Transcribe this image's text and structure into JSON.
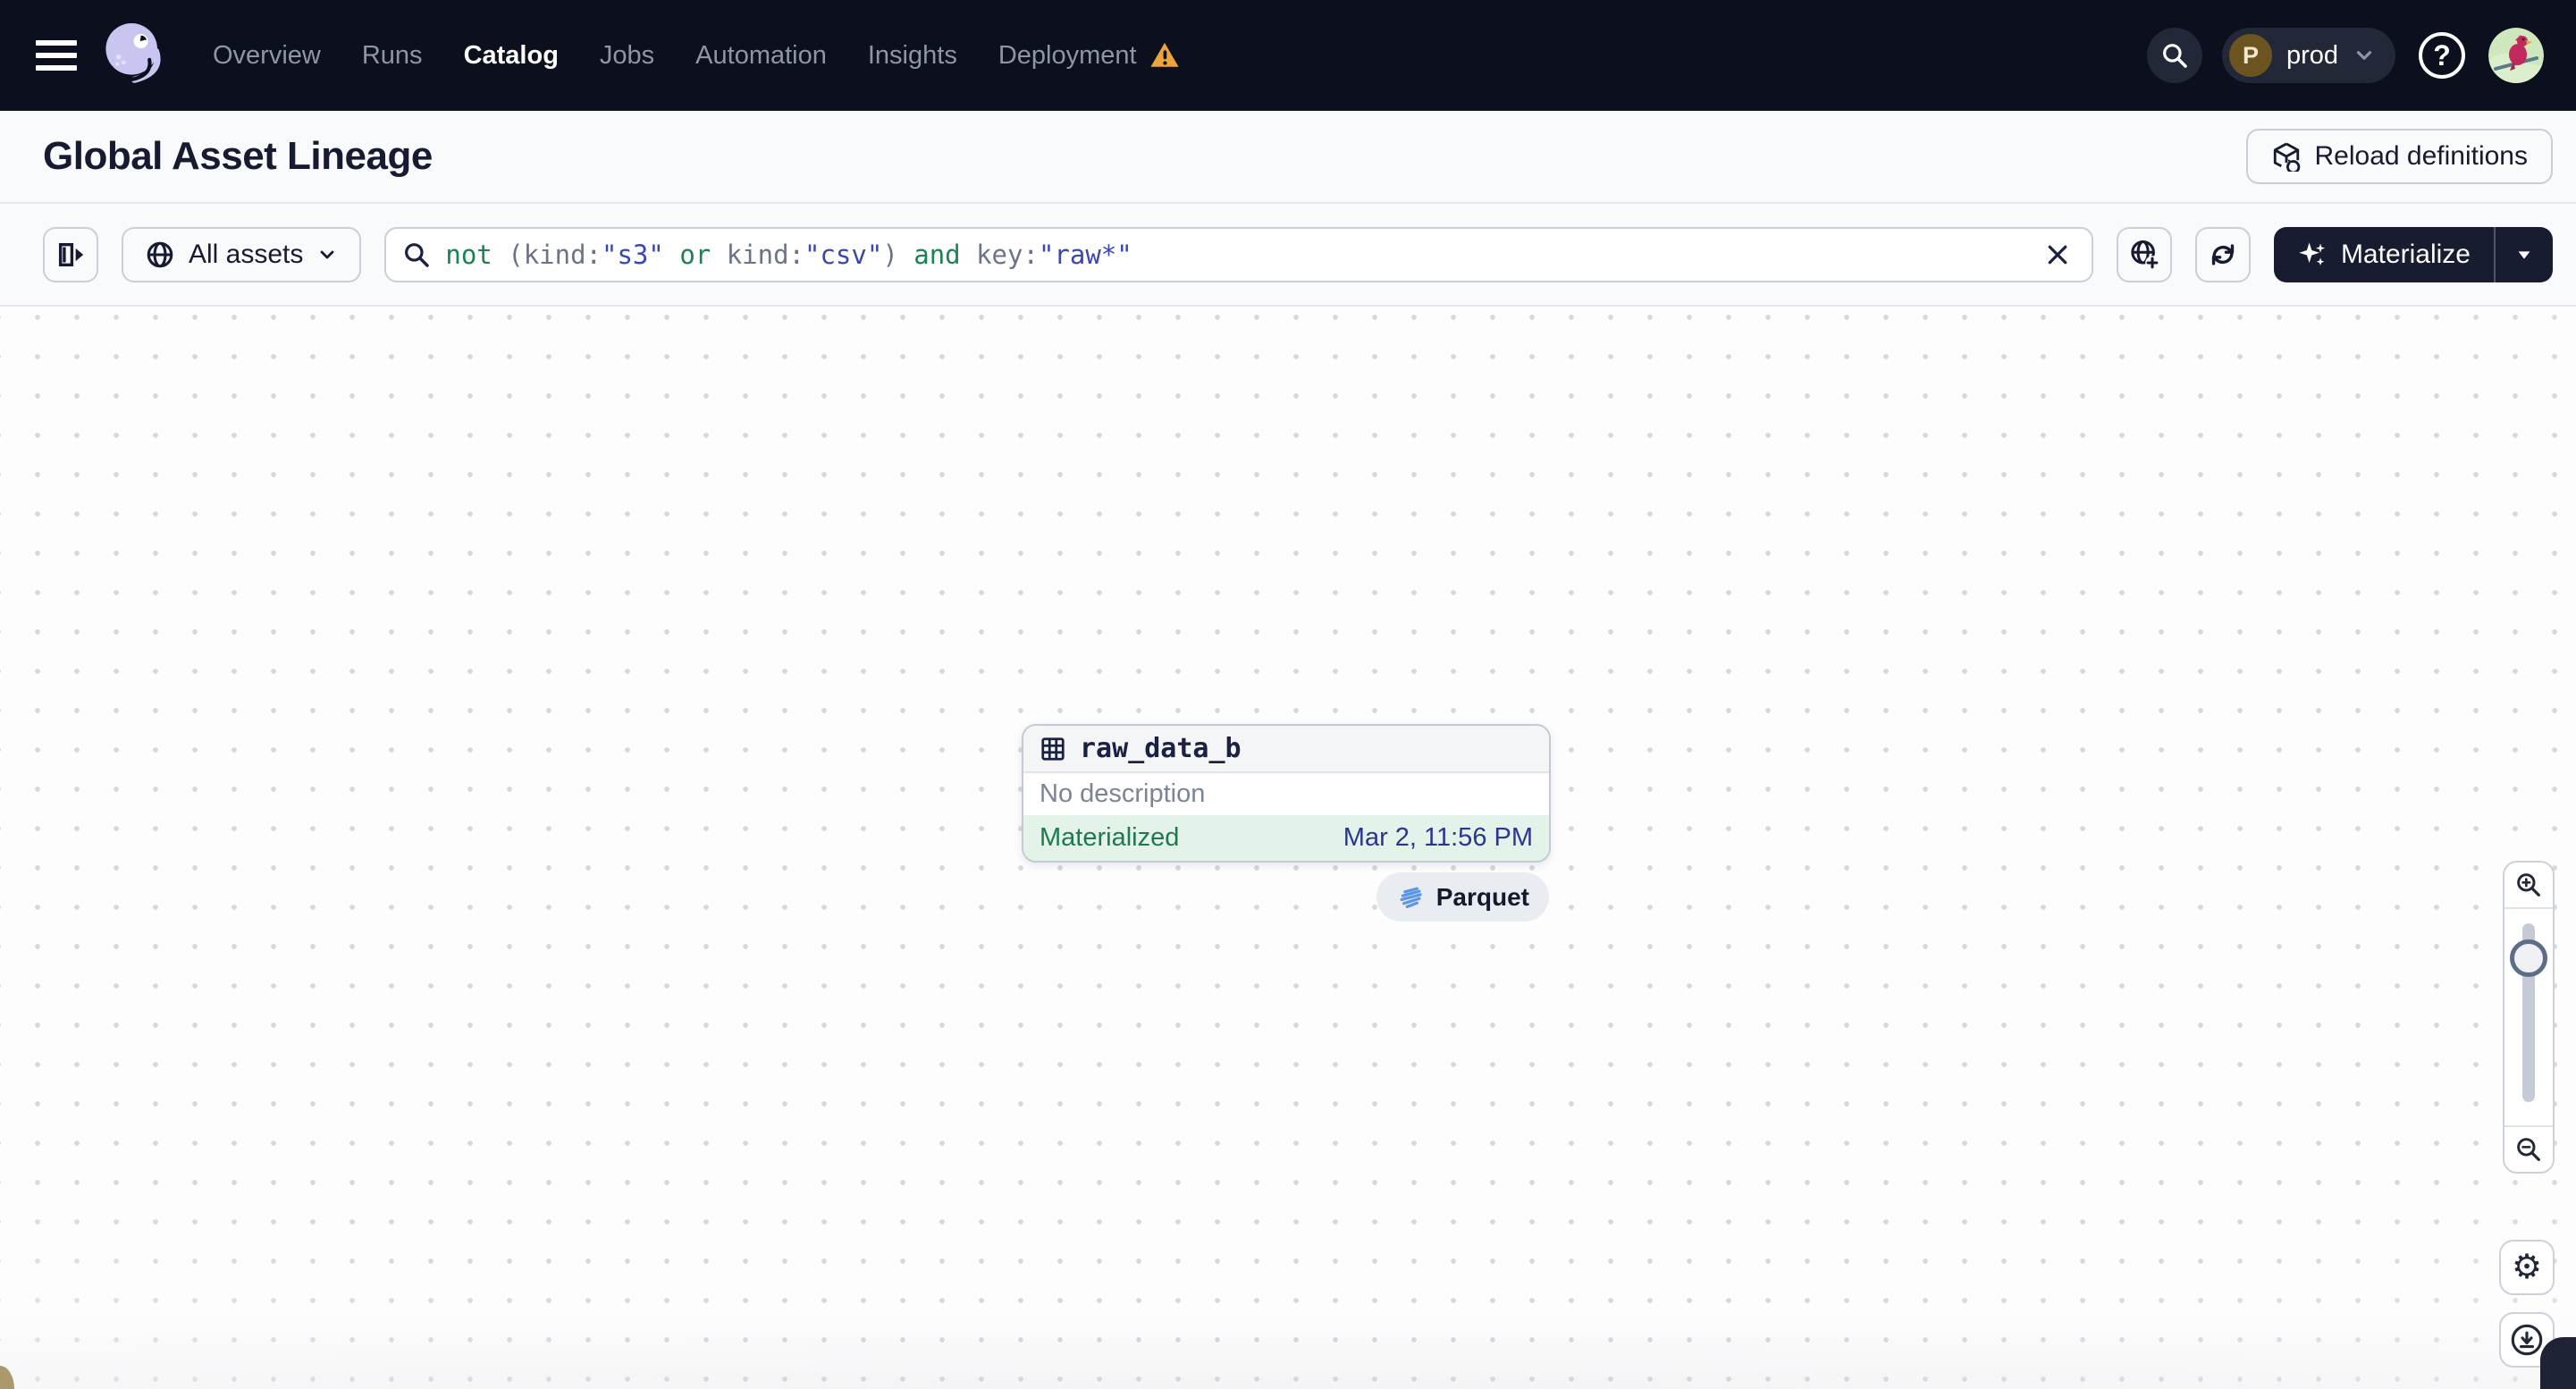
{
  "nav": {
    "items": [
      {
        "label": "Overview"
      },
      {
        "label": "Runs"
      },
      {
        "label": "Catalog"
      },
      {
        "label": "Jobs"
      },
      {
        "label": "Automation"
      },
      {
        "label": "Insights"
      },
      {
        "label": "Deployment"
      }
    ],
    "active_item": "Catalog",
    "env": {
      "initial": "P",
      "label": "prod"
    }
  },
  "header": {
    "title": "Global Asset Lineage",
    "reload_label": "Reload definitions"
  },
  "toolbar": {
    "scope_label": "All assets",
    "query_tokens": [
      {
        "text": "not ",
        "type": "operator"
      },
      {
        "text": "(kind:",
        "type": "field"
      },
      {
        "text": "\"s3\"",
        "type": "value"
      },
      {
        "text": " ",
        "type": "field"
      },
      {
        "text": "or",
        "type": "operator"
      },
      {
        "text": " kind:",
        "type": "field"
      },
      {
        "text": "\"csv\"",
        "type": "value"
      },
      {
        "text": ") ",
        "type": "field"
      },
      {
        "text": "and",
        "type": "operator"
      },
      {
        "text": " key:",
        "type": "field"
      },
      {
        "text": "\"raw*\"",
        "type": "value"
      }
    ],
    "materialize_label": "Materialize"
  },
  "canvas": {
    "node": {
      "name": "raw_data_b",
      "description": "No description",
      "status": "Materialized",
      "timestamp": "Mar 2, 11:56 PM"
    },
    "tag": {
      "label": "Parquet"
    }
  },
  "colors": {
    "navbar_bg": "#0c0f1d",
    "warning_orange": "#eba33c",
    "query_operator_green": "#1e8150",
    "query_field_gray": "#6b7487",
    "query_value_blue": "#3b47b0",
    "materialized_bg": "#e3f3e9",
    "materialized_green": "#1d7a4b",
    "timestamp_indigo": "#2b3693",
    "parquet_blue": "#5b95e8",
    "materialize_btn_bg": "#171c30"
  }
}
